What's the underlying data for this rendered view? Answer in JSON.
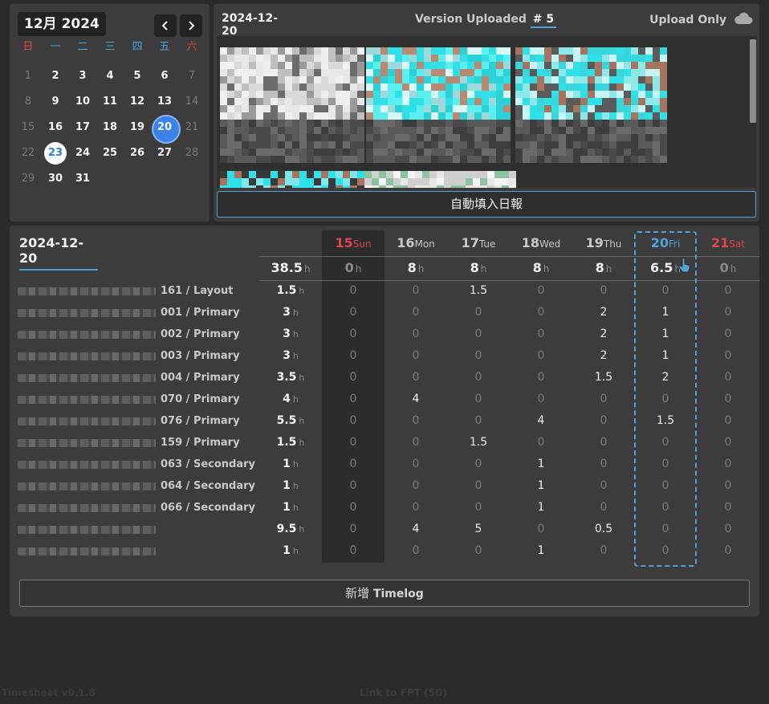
{
  "calendar": {
    "title": "12月 2024",
    "prev_icon": "chevron-left-icon",
    "next_icon": "chevron-right-icon",
    "weekdays": [
      "日",
      "一",
      "二",
      "三",
      "四",
      "五",
      "六"
    ],
    "days": [
      "1",
      "2",
      "3",
      "4",
      "5",
      "6",
      "7",
      "8",
      "9",
      "10",
      "11",
      "12",
      "13",
      "14",
      "15",
      "16",
      "17",
      "18",
      "19",
      "20",
      "21",
      "22",
      "23",
      "24",
      "25",
      "26",
      "27",
      "28",
      "29",
      "30",
      "31"
    ],
    "selected_day": "20",
    "today_day": "23"
  },
  "preview": {
    "date": "2024-12-20",
    "version_label": "Version Uploaded",
    "version_number": "# 5",
    "upload_label": "Upload Only",
    "upload_icon": "cloud-icon",
    "autofill_label": "自動填入日報"
  },
  "timesheet": {
    "date": "2024-12-20",
    "days": [
      {
        "num": "15",
        "name": "Sun",
        "total": "0",
        "style": "weekend"
      },
      {
        "num": "16",
        "name": "Mon",
        "total": "8",
        "style": "normal"
      },
      {
        "num": "17",
        "name": "Tue",
        "total": "8",
        "style": "normal"
      },
      {
        "num": "18",
        "name": "Wed",
        "total": "8",
        "style": "normal"
      },
      {
        "num": "19",
        "name": "Thu",
        "total": "8",
        "style": "normal"
      },
      {
        "num": "20",
        "name": "Fri",
        "total": "6.5",
        "style": "selected"
      },
      {
        "num": "21",
        "name": "Sat",
        "total": "0",
        "style": "weekend"
      }
    ],
    "week_total": "38.5",
    "hour_unit": "h",
    "rows": [
      {
        "code": "161",
        "type": "Layout",
        "hours": "1.5",
        "values": [
          "0",
          "0",
          "1.5",
          "0",
          "0",
          "0",
          "0"
        ]
      },
      {
        "code": "001",
        "type": "Primary",
        "hours": "3",
        "values": [
          "0",
          "0",
          "0",
          "0",
          "2",
          "1",
          "0"
        ]
      },
      {
        "code": "002",
        "type": "Primary",
        "hours": "3",
        "values": [
          "0",
          "0",
          "0",
          "0",
          "2",
          "1",
          "0"
        ]
      },
      {
        "code": "003",
        "type": "Primary",
        "hours": "3",
        "values": [
          "0",
          "0",
          "0",
          "0",
          "2",
          "1",
          "0"
        ]
      },
      {
        "code": "004",
        "type": "Primary",
        "hours": "3.5",
        "values": [
          "0",
          "0",
          "0",
          "0",
          "1.5",
          "2",
          "0"
        ]
      },
      {
        "code": "070",
        "type": "Primary",
        "hours": "4",
        "values": [
          "0",
          "4",
          "0",
          "0",
          "0",
          "0",
          "0"
        ]
      },
      {
        "code": "076",
        "type": "Primary",
        "hours": "5.5",
        "values": [
          "0",
          "0",
          "0",
          "4",
          "0",
          "1.5",
          "0"
        ]
      },
      {
        "code": "159",
        "type": "Primary",
        "hours": "1.5",
        "values": [
          "0",
          "0",
          "1.5",
          "0",
          "0",
          "0",
          "0"
        ]
      },
      {
        "code": "063",
        "type": "Secondary",
        "hours": "1",
        "values": [
          "0",
          "0",
          "0",
          "1",
          "0",
          "0",
          "0"
        ]
      },
      {
        "code": "064",
        "type": "Secondary",
        "hours": "1",
        "values": [
          "0",
          "0",
          "0",
          "1",
          "0",
          "0",
          "0"
        ]
      },
      {
        "code": "066",
        "type": "Secondary",
        "hours": "1",
        "values": [
          "0",
          "0",
          "0",
          "1",
          "0",
          "0",
          "0"
        ]
      },
      {
        "code": "",
        "type": "",
        "hours": "9.5",
        "values": [
          "0",
          "4",
          "5",
          "0",
          "0.5",
          "0",
          "0"
        ]
      },
      {
        "code": "",
        "type": "",
        "hours": "1",
        "values": [
          "0",
          "0",
          "0",
          "1",
          "0",
          "0",
          "0"
        ]
      }
    ],
    "add_label_zh": "新增",
    "add_label_en": "Timelog",
    "cursor_icon": "pointer-hand-icon"
  },
  "footer": {
    "version": "Timesheet v0.1.8",
    "link": "Link to FPT (5G)"
  },
  "colors": {
    "accent": "#4fa3d8",
    "weekend": "#e0454a",
    "selected_day": "#3b82e6"
  }
}
